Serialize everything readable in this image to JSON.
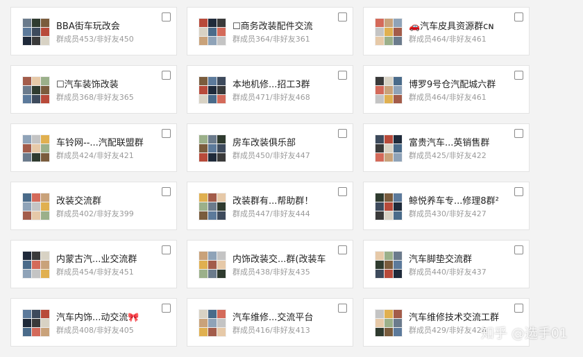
{
  "groups": [
    {
      "name": "BBA街车玩改会",
      "members": "群成员453/非好友450"
    },
    {
      "name": "☐商务改装配件交流",
      "members": "群成员364/非好友361"
    },
    {
      "name": "🚗汽车皮具资源群ᴄɴ",
      "members": "群成员464/非好友461"
    },
    {
      "name": "☐汽车装饰改装",
      "members": "群成员368/非好友365"
    },
    {
      "name": "本地机修...招工3群",
      "members": "群成员471/非好友468"
    },
    {
      "name": "博罗9号仓汽配城六群",
      "members": "群成员464/非好友461"
    },
    {
      "name": "车铃网--...汽配联盟群",
      "members": "群成员424/非好友421"
    },
    {
      "name": "房车改装俱乐部",
      "members": "群成员450/非好友447"
    },
    {
      "name": "富贵汽车...英销售群",
      "members": "群成员425/非好友422"
    },
    {
      "name": "改装交流群",
      "members": "群成员402/非好友399"
    },
    {
      "name": "改装群有...帮助群！",
      "members": "群成员447/非好友444"
    },
    {
      "name": "鲸悦养车专...修理8群²",
      "members": "群成员430/非好友427"
    },
    {
      "name": "内蒙古汽...业交流群",
      "members": "群成员454/非好友451"
    },
    {
      "name": "内饰改装交...群(改装车",
      "members": "群成员438/非好友435"
    },
    {
      "name": "汽车脚垫交流群",
      "members": "群成员440/非好友437"
    },
    {
      "name": "汽车内饰...动交流🎀",
      "members": "群成员408/非好友405"
    },
    {
      "name": "汽车维修...交流平台",
      "members": "群成员416/非好友413"
    },
    {
      "name": "汽车维修技术交流工群",
      "members": "群成员429/非好友426"
    }
  ],
  "watermark": "知乎 @选手01",
  "colors": {
    "background": "#f3f3f3",
    "card": "#ffffff",
    "title": "#222222",
    "meta": "#9a9a9a"
  },
  "avatar_palette": [
    "#6b7b8c",
    "#c9a27a",
    "#3d4a5c",
    "#a35c4a",
    "#d8d2c4",
    "#2f3b2f",
    "#8fa3b8",
    "#b84a3a",
    "#e6c9a8",
    "#4a6b8a",
    "#7a5c3d",
    "#c4c4c4",
    "#1f2a3a",
    "#9bb08a",
    "#d46a5a",
    "#5c7a9b",
    "#e0b050",
    "#3a3a3a"
  ]
}
